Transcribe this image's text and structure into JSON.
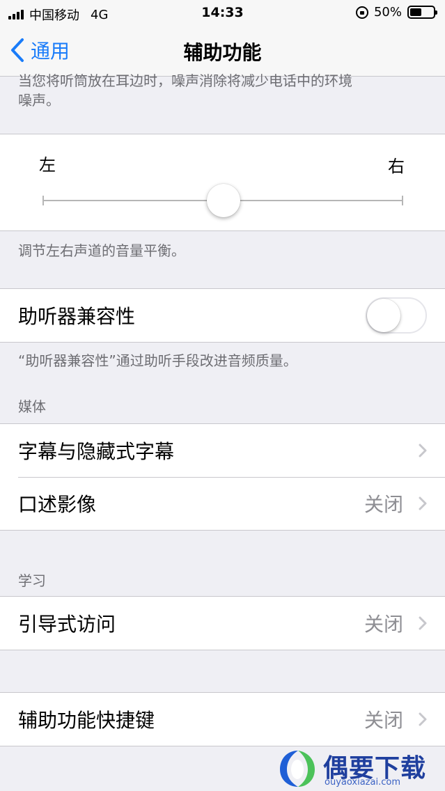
{
  "status_bar": {
    "carrier": "中国移动",
    "network": "4G",
    "time": "14:33",
    "battery": "50%",
    "battery_level": 0.5
  },
  "nav": {
    "back_label": "通用",
    "title": "辅助功能"
  },
  "noise_cancel_footer": "当您将听筒放在耳边时，噪声消除将减少电话中的环境噪声。",
  "balance": {
    "left_label": "左",
    "right_label": "右",
    "value": 0.5,
    "footer": "调节左右声道的音量平衡。"
  },
  "hearing_aid": {
    "label": "助听器兼容性",
    "enabled": false,
    "footer": "“助听器兼容性”通过助听手段改进音频质量。"
  },
  "media": {
    "header": "媒体",
    "items": [
      {
        "label": "字幕与隐藏式字幕",
        "value": ""
      },
      {
        "label": "口述影像",
        "value": "关闭"
      }
    ]
  },
  "learning": {
    "header": "学习",
    "items": [
      {
        "label": "引导式访问",
        "value": "关闭"
      }
    ]
  },
  "shortcut": {
    "label": "辅助功能快捷键",
    "value": "关闭"
  },
  "watermark": {
    "title": "偶要下载站",
    "subtitle": "ouyaoxiazai.com"
  },
  "colors": {
    "accent": "#1a7cf9",
    "background": "#efeff4",
    "secondary_text": "#8e8e93"
  }
}
